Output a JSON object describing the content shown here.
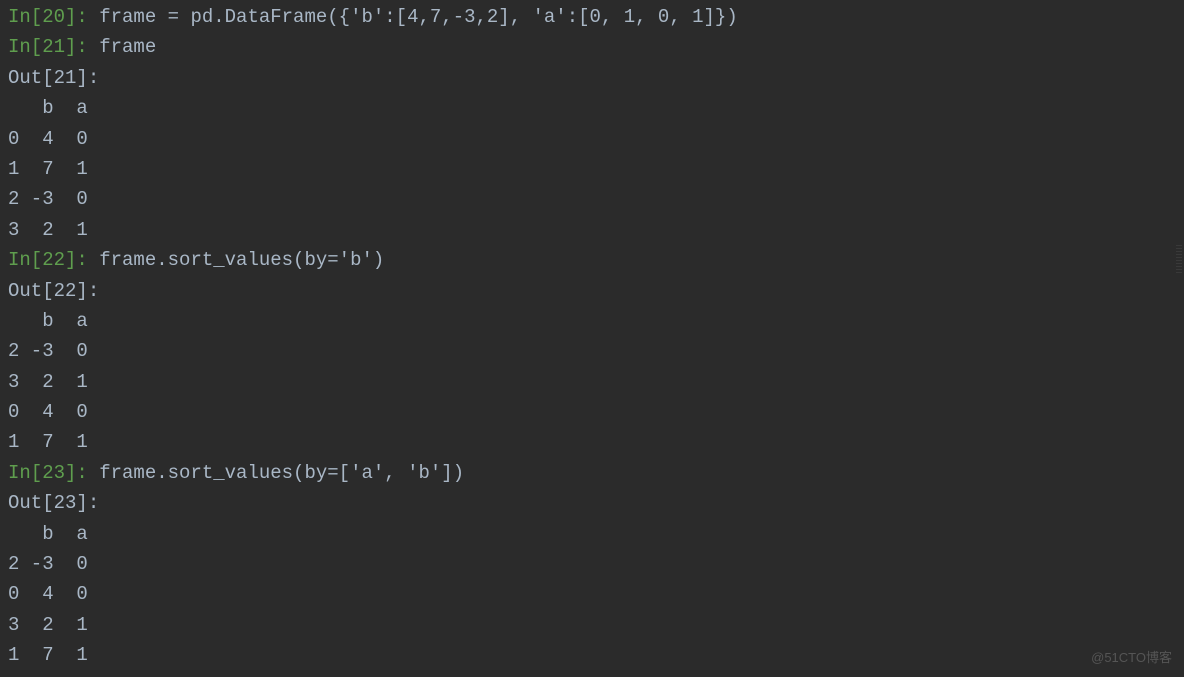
{
  "cells": [
    {
      "in_prompt": "In[20]:",
      "in_code": " frame = pd.DataFrame({'b':[4,7,-3,2], 'a':[0, 1, 0, 1]})"
    },
    {
      "in_prompt": "In[21]:",
      "in_code": " frame",
      "out_prompt": "Out[21]:",
      "out_lines": [
        "   b  a",
        "0  4  0",
        "1  7  1",
        "2 -3  0",
        "3  2  1"
      ]
    },
    {
      "in_prompt": "In[22]:",
      "in_code": " frame.sort_values(by='b')",
      "out_prompt": "Out[22]:",
      "out_lines": [
        "   b  a",
        "2 -3  0",
        "3  2  1",
        "0  4  0",
        "1  7  1"
      ]
    },
    {
      "in_prompt": "In[23]:",
      "in_code": " frame.sort_values(by=['a', 'b'])",
      "out_prompt": "Out[23]:",
      "out_lines": [
        "   b  a",
        "2 -3  0",
        "0  4  0",
        "3  2  1",
        "1  7  1"
      ]
    }
  ],
  "watermark": "@51CTO博客"
}
